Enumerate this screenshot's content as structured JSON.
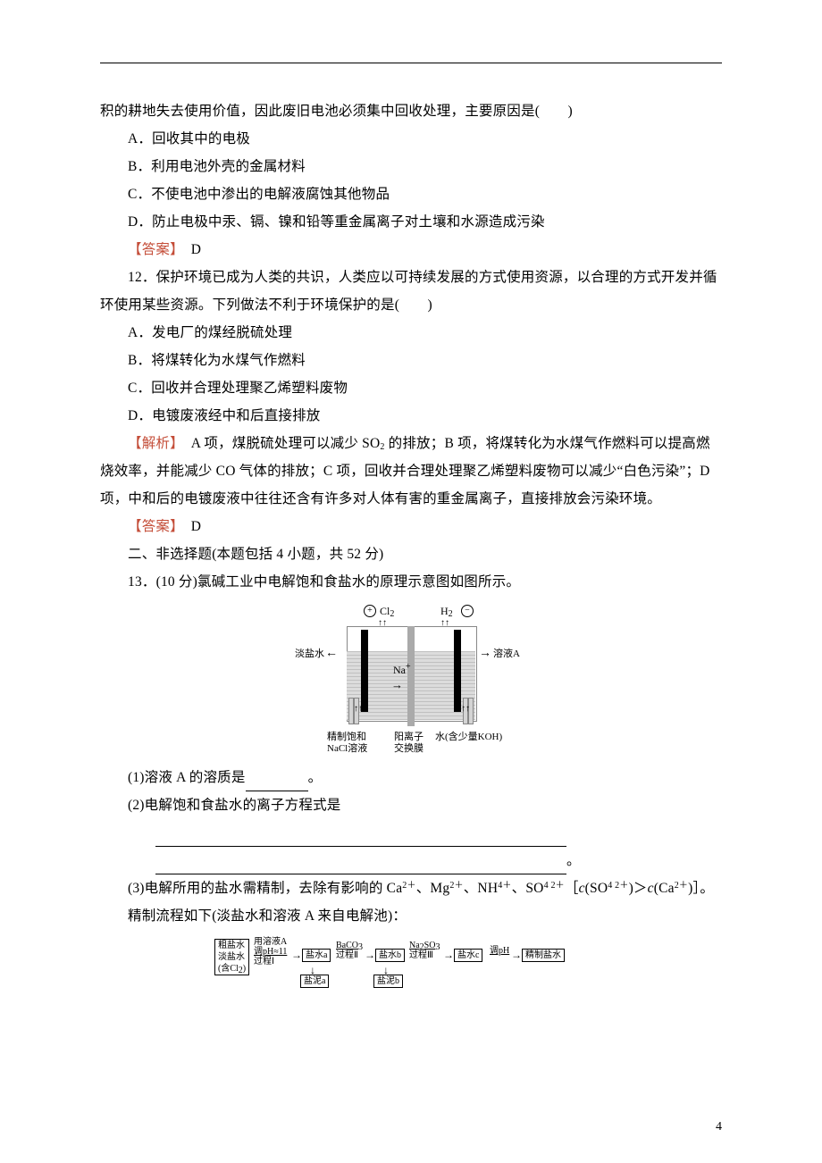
{
  "intro": "积的耕地失去使用价值，因此废旧电池必须集中回收处理，主要原因是(　　)",
  "q11": {
    "A": "A．回收其中的电极",
    "B": "B．利用电池外壳的金属材料",
    "C": "C．不使电池中渗出的电解液腐蚀其他物品",
    "D": "D．防止电极中汞、镉、镍和铅等重金属离子对土壤和水源造成污染",
    "ansLabel": "【答案】",
    "ans": "　D"
  },
  "q12": {
    "stem": "12．保护环境已成为人类的共识，人类应以可持续发展的方式使用资源，以合理的方式开发并循环使用某些资源。下列做法不利于环境保护的是(　　)",
    "A": "A．发电厂的煤经脱硫处理",
    "B": "B．将煤转化为水煤气作燃料",
    "C": "C．回收并合理处理聚乙烯塑料废物",
    "D": "D．电镀废液经中和后直接排放",
    "expLabel": "【解析】",
    "exp1_a": "　A 项，煤脱硫处理可以减少 SO",
    "exp1_sub": "2",
    "exp1_b": " 的排放；B 项，将煤转化为水煤气作燃料可以提高燃烧效率，并能减少 CO 气体的排放；C 项，回收并合理处理聚乙烯塑料废物可以减少“白色污染”；D 项，中和后的电镀废液中往往还含有许多对人体有害的重金属离子，直接排放会污染环境。",
    "ansLabel": "【答案】",
    "ans": "　D"
  },
  "sec2": "二、非选择题(本题包括 4 小题，共 52 分)",
  "q13": {
    "stem": "13．(10 分)氯碱工业中电解饱和食盐水的原理示意图如图所示。",
    "p1_a": "(1)溶液 A 的溶质是",
    "p1_b": "。",
    "p2": "(2)电解饱和食盐水的离子方程式是",
    "tail": "。",
    "p3_a": "(3)电解所用的盐水需精制，去除有影响的 Ca",
    "p3_b": "、Mg",
    "p3_c": "、NH",
    "p3_d": "、SO",
    "p3_e": "［",
    "p3_f": "(SO",
    "p3_g": ")＞",
    "p3_h": "(Ca",
    "p3_i": ")］。",
    "sup2p": "2＋",
    "sup4p": "4＋",
    "sup42m": "4 2＋",
    "italic_c": "c",
    "p4": "精制流程如下(淡盐水和溶液 A 来自电解池)："
  },
  "cell": {
    "plus": "+",
    "minus": "−",
    "cl2a": "Cl",
    "cl2b": "2",
    "h2a": "H",
    "h2b": "2",
    "up": "↑↑",
    "dan": "淡盐水",
    "solA": "溶液A",
    "larrow": "←",
    "rarrow": "→",
    "naA": "Na",
    "naB": "+",
    "naarr": "→",
    "in": "↑↑",
    "lbl1a": "精制饱和",
    "lbl1b": "NaCl溶液",
    "lbl2a": "阳离子",
    "lbl2b": "交换膜",
    "lbl3": "水(含少量KOH)"
  },
  "flow": {
    "b1a": "粗盐水",
    "b1b": "淡盐水",
    "b1c": "(含Cl",
    "b1c2": "2",
    "b1d": ")",
    "a1a": "用溶液A",
    "a1b": "调pH≈11",
    "a1c": "过程Ⅰ",
    "b2": "盐水a",
    "e2": "盐泥a",
    "a2a": "BaCO",
    "a2sub": "3",
    "a2b": "过程Ⅱ",
    "b3": "盐水b",
    "e3": "盐泥b",
    "a3a": "Na",
    "a3sub1": "2",
    "a3b": "SO",
    "a3sub2": "3",
    "a3c": "过程Ⅲ",
    "b4": "盐水c",
    "a4": "调pH",
    "b5": "精制盐水",
    "ar": "→",
    "darr": "↓"
  },
  "pagenum": "4"
}
